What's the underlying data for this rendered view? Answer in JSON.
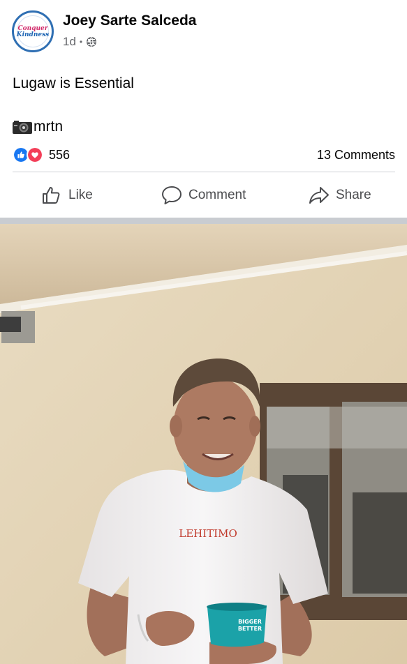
{
  "post": {
    "author_name": "Joey Sarte Salceda",
    "avatar_logo_line1": "Conquer",
    "avatar_logo_line2": "Kindness",
    "time": "1d",
    "separator": "•",
    "privacy_icon": "globe-icon",
    "text": "Lugaw is Essential",
    "credit_icon": "camera-icon",
    "credit": "mrtn"
  },
  "stats": {
    "reaction_icons": [
      "like-reaction-icon",
      "love-reaction-icon"
    ],
    "reaction_count": "556",
    "comments": "13 Comments"
  },
  "actions": {
    "like_label": "Like",
    "comment_label": "Comment",
    "share_label": "Share"
  },
  "photo": {
    "shirt_text": "LEHITIMO",
    "cup_text_1": "BIGGER",
    "cup_text_2": "BETTER"
  },
  "colors": {
    "facebook_blue": "#1877f2",
    "love_red": "#f33e58",
    "secondary_text": "#65676b",
    "mask_blue": "#7cc9e6",
    "cup_teal": "#1ba2a8"
  }
}
